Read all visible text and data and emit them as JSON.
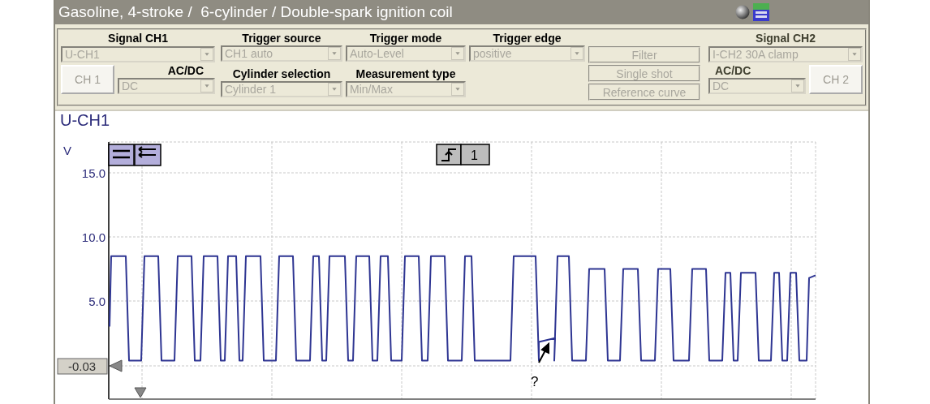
{
  "window": {
    "title": "Gasoline, 4-stroke /  6-cylinder / Double-spark ignition coil"
  },
  "channel_1": {
    "heading": "Signal CH1",
    "signal": {
      "value": "U-CH1",
      "disabled": true
    },
    "channel_button": {
      "label": "CH 1",
      "disabled": true
    },
    "coupling_label": "AC/DC",
    "coupling": {
      "value": "DC",
      "disabled": true
    }
  },
  "trigger_fields": [
    {
      "label": "Trigger source",
      "value": "CH1 auto",
      "disabled": true
    },
    {
      "label": "Trigger mode",
      "value": "Auto-Level",
      "disabled": true
    },
    {
      "label": "Trigger edge",
      "value": "positive",
      "disabled": true
    },
    {
      "label": "Cylinder selection",
      "value": "Cylinder 1",
      "disabled": true
    },
    {
      "label": "Measurement type",
      "value": "Min/Max",
      "disabled": true
    }
  ],
  "buttons": [
    {
      "label": "Filter",
      "disabled": true
    },
    {
      "label": "Single shot",
      "disabled": true
    },
    {
      "label": "Reference curve",
      "disabled": true
    }
  ],
  "channel_2": {
    "heading": "Signal CH2",
    "signal": {
      "value": "I-CH2 30A clamp",
      "disabled": true
    },
    "channel_button": {
      "label": "CH 2",
      "disabled": true
    },
    "coupling_label": "AC/DC",
    "coupling": {
      "value": "DC",
      "disabled": true
    }
  },
  "plot": {
    "title": "U-CH1",
    "unit": "V",
    "y_labels": [
      "15.0",
      "10.0",
      "5.0"
    ],
    "zero_marker": "-0.03",
    "trigger_badge": "1",
    "annotation": "?"
  }
}
